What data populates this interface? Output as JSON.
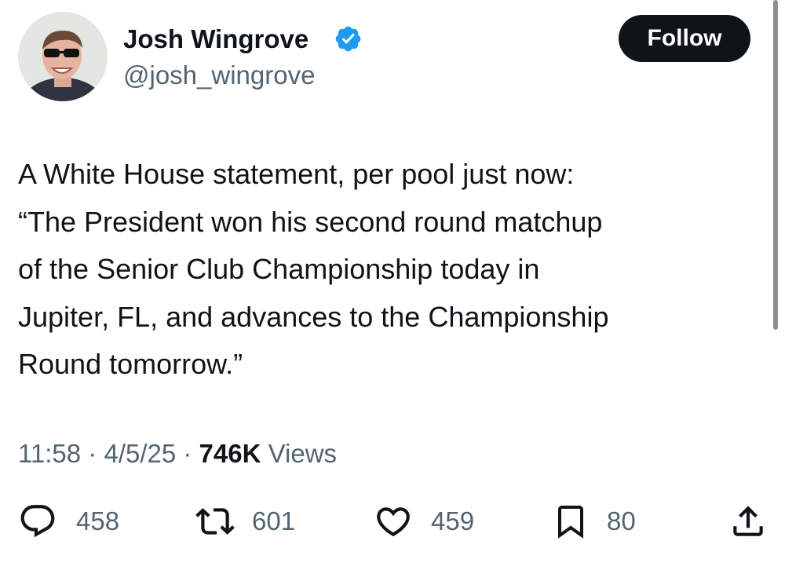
{
  "author": {
    "name": "Josh Wingrove",
    "handle": "@josh_wingrove",
    "verified_color": "#1d9bf0"
  },
  "follow_label": "Follow",
  "tweet": {
    "lines": [
      "A White House statement, per pool just now:",
      "“The President won his second round matchup",
      "of the Senior Club Championship today in",
      "Jupiter, FL, and advances to the Championship",
      "Round tomorrow.”"
    ]
  },
  "meta": {
    "time": "11:58",
    "separator": " · ",
    "date": "4/5/25",
    "views_count": "746K",
    "views_label": " Views"
  },
  "actions": {
    "replies": "458",
    "reposts": "601",
    "likes": "459",
    "bookmarks": "80"
  },
  "icons": [
    "verified-icon",
    "reply-icon",
    "repost-icon",
    "like-icon",
    "bookmark-icon",
    "share-icon"
  ]
}
